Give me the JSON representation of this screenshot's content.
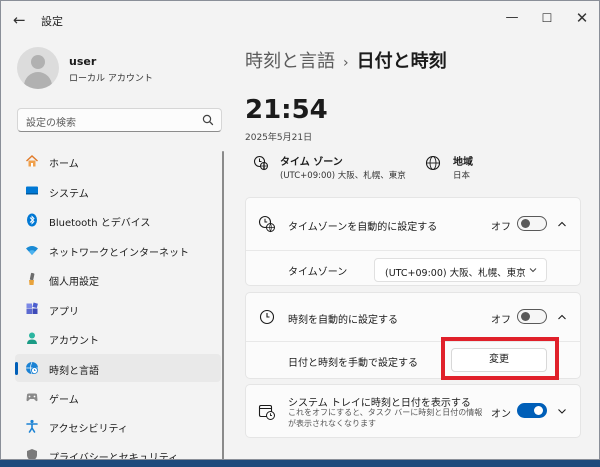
{
  "window": {
    "title": "設定",
    "back_glyph": "←",
    "min_glyph": "—",
    "max_glyph": "☐",
    "close_glyph": "✕"
  },
  "user": {
    "name": "user",
    "account_type": "ローカル アカウント"
  },
  "search": {
    "placeholder": "設定の検索"
  },
  "sidebar": {
    "items": [
      {
        "label": "ホーム",
        "icon": "home-icon"
      },
      {
        "label": "システム",
        "icon": "system-icon"
      },
      {
        "label": "Bluetooth とデバイス",
        "icon": "bluetooth-icon"
      },
      {
        "label": "ネットワークとインターネット",
        "icon": "wifi-icon"
      },
      {
        "label": "個人用設定",
        "icon": "brush-icon"
      },
      {
        "label": "アプリ",
        "icon": "apps-icon"
      },
      {
        "label": "アカウント",
        "icon": "account-icon"
      },
      {
        "label": "時刻と言語",
        "icon": "time-language-icon",
        "active": true
      },
      {
        "label": "ゲーム",
        "icon": "gamepad-icon"
      },
      {
        "label": "アクセシビリティ",
        "icon": "accessibility-icon"
      },
      {
        "label": "プライバシーとセキュリティ",
        "icon": "shield-icon"
      }
    ]
  },
  "breadcrumb": {
    "parent": "時刻と言語",
    "separator": "›",
    "current": "日付と時刻"
  },
  "clock": {
    "time": "21:54",
    "date": "2025年5月21日"
  },
  "info": {
    "timezone_title": "タイム ゾーン",
    "timezone_value": "(UTC+09:00) 大阪、札幌、東京",
    "region_title": "地域",
    "region_value": "日本"
  },
  "settings": {
    "auto_timezone_label": "タイムゾーンを自動的に設定する",
    "auto_timezone_state": "オフ",
    "timezone_label": "タイムゾーン",
    "timezone_selected": "(UTC+09:00) 大阪、札幌、東京",
    "auto_time_label": "時刻を自動的に設定する",
    "auto_time_state": "オフ",
    "manual_label": "日付と時刻を手動で設定する",
    "change_button": "変更",
    "tray_label": "システム トレイに時刻と日付を表示する",
    "tray_desc": "これをオフにすると、タスク バーに時刻と日付の情報が表示されなくなります",
    "tray_state": "オン"
  },
  "colors": {
    "accent": "#005fb8",
    "highlight": "#e0202a",
    "window_bg": "#f3f3f3",
    "card_bg": "#fbfbfb"
  }
}
